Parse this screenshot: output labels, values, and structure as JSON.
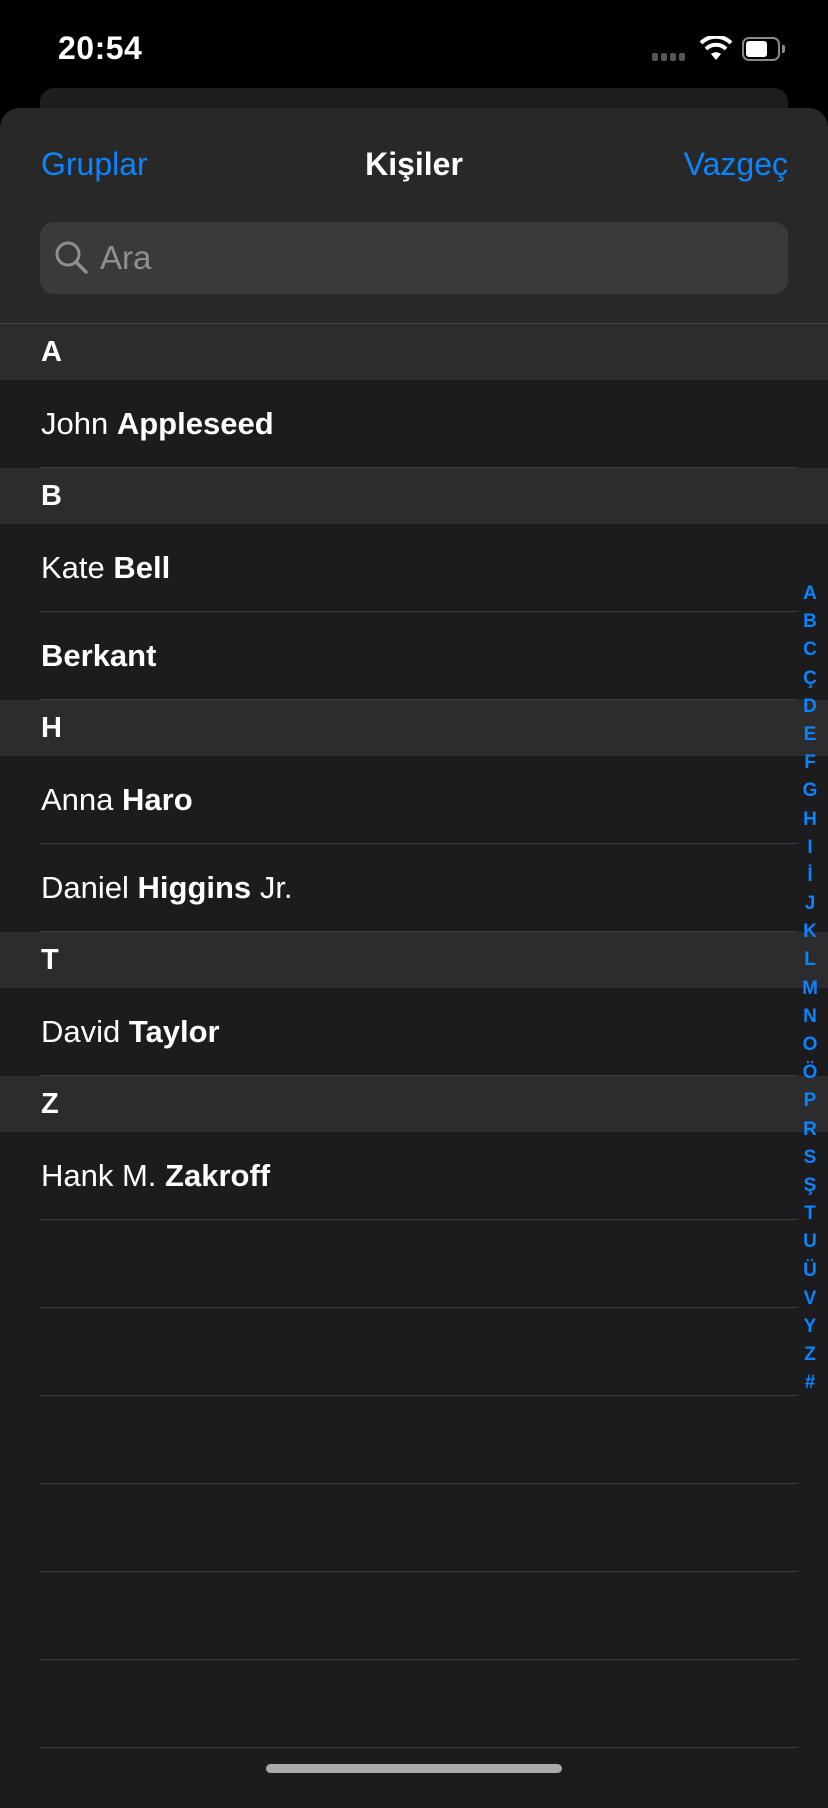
{
  "status": {
    "time": "20:54"
  },
  "nav": {
    "left": "Gruplar",
    "title": "Kişiler",
    "right": "Vazgeç"
  },
  "search": {
    "placeholder": "Ara"
  },
  "sections": [
    {
      "letter": "A",
      "contacts": [
        {
          "first": "John",
          "last": "Appleseed",
          "suffix": ""
        }
      ]
    },
    {
      "letter": "B",
      "contacts": [
        {
          "first": "Kate",
          "last": "Bell",
          "suffix": ""
        },
        {
          "first": "",
          "last": "Berkant",
          "suffix": ""
        }
      ]
    },
    {
      "letter": "H",
      "contacts": [
        {
          "first": "Anna",
          "last": "Haro",
          "suffix": ""
        },
        {
          "first": "Daniel",
          "last": "Higgins",
          "suffix": "Jr."
        }
      ]
    },
    {
      "letter": "T",
      "contacts": [
        {
          "first": "David",
          "last": "Taylor",
          "suffix": ""
        }
      ]
    },
    {
      "letter": "Z",
      "contacts": [
        {
          "first": "Hank M.",
          "last": "Zakroff",
          "suffix": ""
        }
      ]
    }
  ],
  "index": [
    "A",
    "B",
    "C",
    "Ç",
    "D",
    "E",
    "F",
    "G",
    "H",
    "I",
    "İ",
    "J",
    "K",
    "L",
    "M",
    "N",
    "O",
    "Ö",
    "P",
    "R",
    "S",
    "Ş",
    "T",
    "U",
    "Ü",
    "V",
    "Y",
    "Z",
    "#"
  ],
  "colors": {
    "accent": "#0a84ff",
    "background": "#1c1c1e",
    "section": "#2c2c2e"
  }
}
